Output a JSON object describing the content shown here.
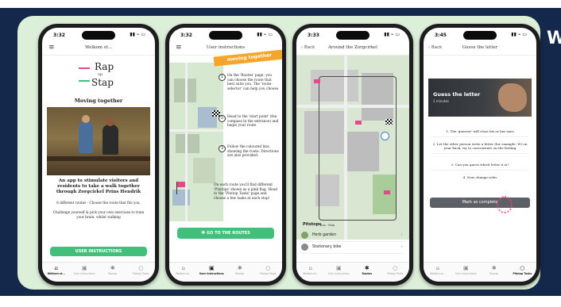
{
  "colors": {
    "navy": "#13284a",
    "mint": "#dcefd8",
    "green": "#42bf7a",
    "orange": "#f5a52a",
    "pink": "#e8488a"
  },
  "corner_letter": "W",
  "status": {
    "icons": "▮▮ ⌁ ▭"
  },
  "tabs": [
    {
      "label": "Welkom st...",
      "icon": "home-icon"
    },
    {
      "label": "User instructions",
      "icon": "book-icon"
    },
    {
      "label": "Routes",
      "icon": "people-icon"
    },
    {
      "label": "Pitstop Tasks",
      "icon": "chat-icon"
    }
  ],
  "phone1": {
    "time": "3:32",
    "title": "Welkom st...",
    "logo": {
      "word1": "Rap",
      "word2": "op",
      "word3": "Stap"
    },
    "heading": "Moving together",
    "tagline": "An app to stimulate visitors and residents to take a walk together through Zorgcirkel Prins Hendrik",
    "line1": "8 different routes - Choose the route that fits you.",
    "line2": "Challenge yourself & pick your own exercises to train your brain, whilst walking",
    "button": "USER INSTRUCTIONS"
  },
  "phone2": {
    "time": "3:32",
    "title": "User instructions",
    "banner": "moving together",
    "steps": [
      {
        "num": "1",
        "text": "On the 'Routes' page, you can choose the route that best suits you. The 'route-selector' can help you choose"
      },
      {
        "num": "2",
        "text": "Head to the 'start point' (the compass in the entrance) and begin your route"
      },
      {
        "num": "3",
        "text": "Follow the coloured line, showing the route. Directions are also provided."
      }
    ],
    "extra": "On each route you'll find different 'Pitstops' shown as a pink flag. Head to the 'Pitstop Tasks' page and choose a few tasks at each stop!",
    "button": "GO TO THE ROUTES"
  },
  "phone3": {
    "time": "3:33",
    "back": "Back",
    "title": "Around the Zorgcirkel",
    "legend": [
      "Bus",
      "Stop"
    ],
    "pitstops_label": "Pitstops",
    "pitstops": [
      "Herb garden",
      "Stationary bike"
    ]
  },
  "phone4": {
    "time": "3:45",
    "back": "Back",
    "title": "Guess the letter",
    "hero_title": "Guess the letter",
    "hero_sub": "2 minutes",
    "steps": [
      "1. The 'guesser' will close his or her eyes",
      "2. Let the other person write a letter (for example: W) on your back, try to concentrate on the feeling",
      "3. Can you guess which letter it is?",
      "4. Now change roles"
    ],
    "button": "Mark as complete"
  }
}
